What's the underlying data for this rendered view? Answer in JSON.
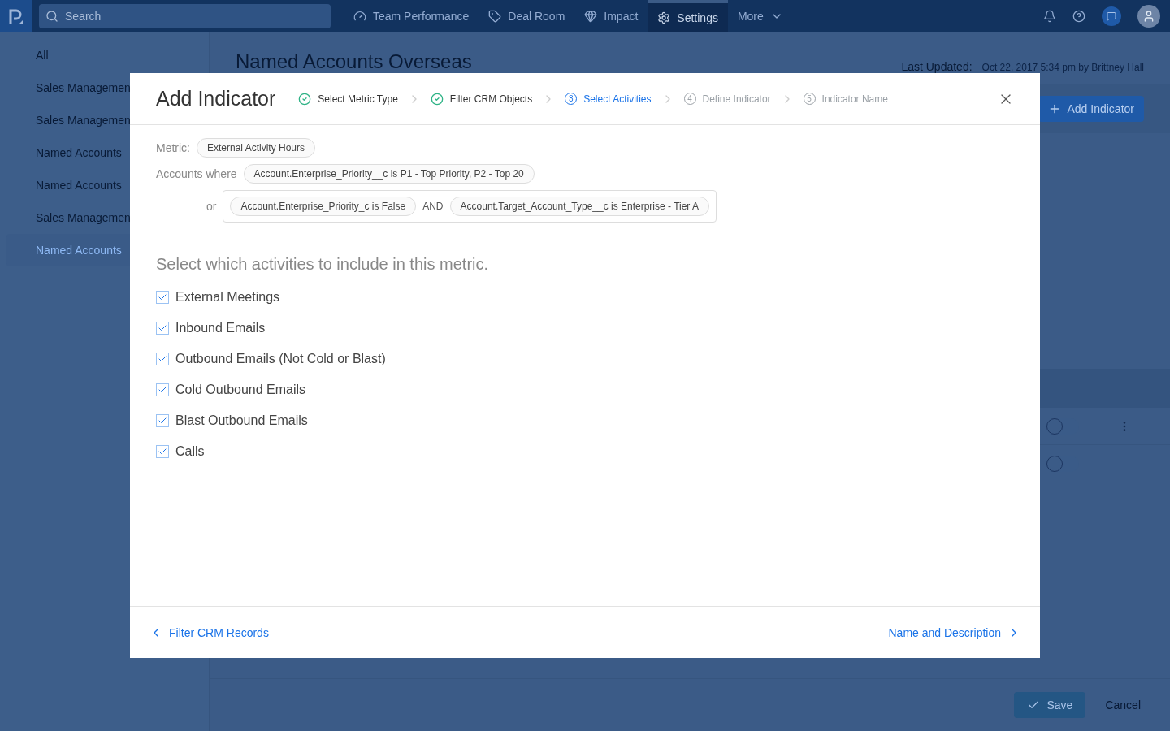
{
  "nav": {
    "search": {
      "placeholder": "Search"
    },
    "items": [
      {
        "label": "Team Performance",
        "kind": "gauge",
        "selected": false
      },
      {
        "label": "Deal Room",
        "kind": "tag",
        "selected": false
      },
      {
        "label": "Impact",
        "kind": "gem",
        "selected": false
      },
      {
        "label": "Settings",
        "kind": "gear",
        "selected": true
      },
      {
        "label": "More",
        "kind": "more",
        "selected": false
      }
    ]
  },
  "sidebar": {
    "items": [
      {
        "label": "All",
        "selected": false
      },
      {
        "label": "Sales Managemen",
        "selected": false
      },
      {
        "label": "Sales Managemen",
        "selected": false
      },
      {
        "label": "Named Accounts",
        "selected": false
      },
      {
        "label": "Named Accounts",
        "selected": false
      },
      {
        "label": "Sales Managemen",
        "selected": false
      },
      {
        "label": "Named Accounts",
        "selected": true
      }
    ]
  },
  "page": {
    "title": "Named Accounts Overseas",
    "last_updated_label": "Last Updated:",
    "last_updated": "Oct 22, 2017 5:34 pm by Brittney Hall",
    "add_button": "Add Indicator",
    "rows": [
      {
        "on": false,
        "menu": true
      },
      {
        "on": false,
        "menu": false
      }
    ],
    "save": "Save",
    "cancel": "Cancel"
  },
  "dialog": {
    "title": "Add Indicator",
    "steps": [
      {
        "label": "Select Metric Type",
        "done": true,
        "current": false
      },
      {
        "label": "Filter CRM Objects",
        "done": true,
        "current": false
      },
      {
        "number": "3",
        "label": "Select Activities",
        "done": false,
        "current": true
      },
      {
        "number": "4",
        "label": "Define Indicator",
        "done": false,
        "current": false
      },
      {
        "number": "5",
        "label": "Indicator Name",
        "done": false,
        "current": false
      }
    ],
    "metric_label": "Metric:",
    "metric": "External Activity Hours",
    "accounts_label": "Accounts where",
    "condition": "Account.Enterprise_Priority__c is P1 - Top Priority, P2 - Top 20",
    "or_label": "or",
    "or_conditions": [
      "Account.Enterprise_Priority_c is False",
      "Account.Target_Account_Type__c is Enterprise - Tier A"
    ],
    "and_label": "AND",
    "prompt": "Select which activities to include in this metric.",
    "activities": [
      {
        "label": "External Meetings",
        "checked": true
      },
      {
        "label": "Inbound Emails",
        "checked": true
      },
      {
        "label": "Outbound Emails (Not Cold or Blast)",
        "checked": true
      },
      {
        "label": "Cold Outbound Emails",
        "checked": true
      },
      {
        "label": "Blast Outbound Emails",
        "checked": true
      },
      {
        "label": "Calls",
        "checked": true
      }
    ],
    "back": "Filter CRM Records",
    "next": "Name and Description"
  }
}
